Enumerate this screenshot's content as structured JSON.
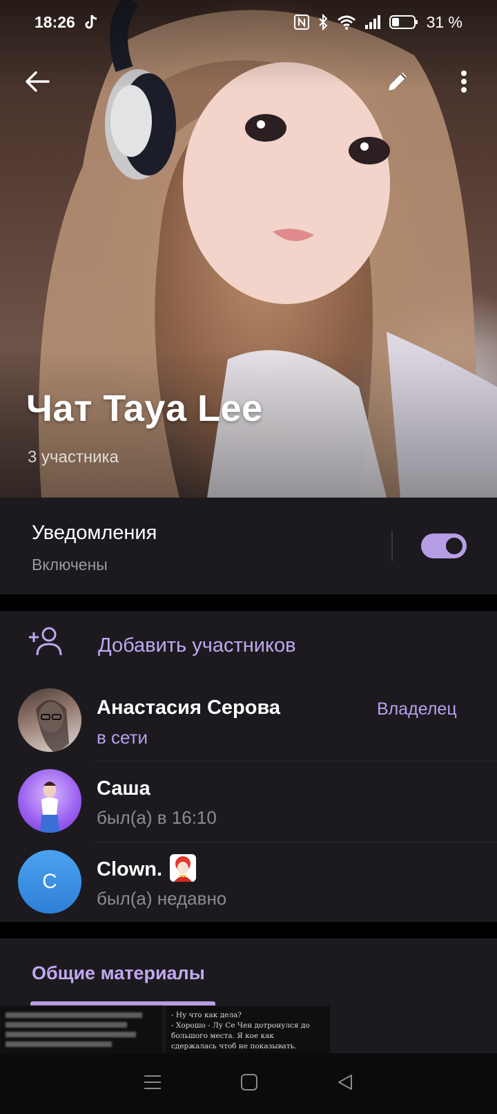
{
  "status_bar": {
    "time": "18:26",
    "battery": "31 %",
    "icons": [
      "tiktok-icon",
      "nfc-icon",
      "bluetooth-icon",
      "wifi-icon",
      "signal-icon",
      "battery-icon"
    ]
  },
  "header": {
    "title": "Чат Taya Lee",
    "subtitle": "3 участника",
    "back_icon": "back-arrow-icon",
    "edit_icon": "pencil-icon",
    "more_icon": "more-vert-icon"
  },
  "notifications": {
    "title": "Уведомления",
    "state": "Включены",
    "toggle_on": true
  },
  "members": {
    "add_label": "Добавить участников",
    "list": [
      {
        "name": "Анастасия Серова",
        "status": "в сети",
        "role": "Владелец",
        "online": true
      },
      {
        "name": "Саша",
        "status": "был(а) в 16:10",
        "role": "",
        "online": false
      },
      {
        "name": "Clown.",
        "status": "был(а) недавно",
        "role": "",
        "online": false,
        "initial": "C"
      }
    ]
  },
  "shared_media": {
    "title": "Общие материалы",
    "thumb2_lines": [
      "- Ну что как дела?",
      "- Хорошо - Лу Се Чен дотронулся до",
      "большого места. Я кое как",
      "сдержалась чтоб не показывать."
    ]
  },
  "colors": {
    "accent": "#b69ee4",
    "accent_text": "#c2a8f0",
    "surface": "#1c1a1f",
    "background": "#000000",
    "clown_avatar": "#3b8de0"
  },
  "navbar": {
    "icons": [
      "menu-icon",
      "home-square-icon",
      "back-triangle-icon"
    ]
  }
}
